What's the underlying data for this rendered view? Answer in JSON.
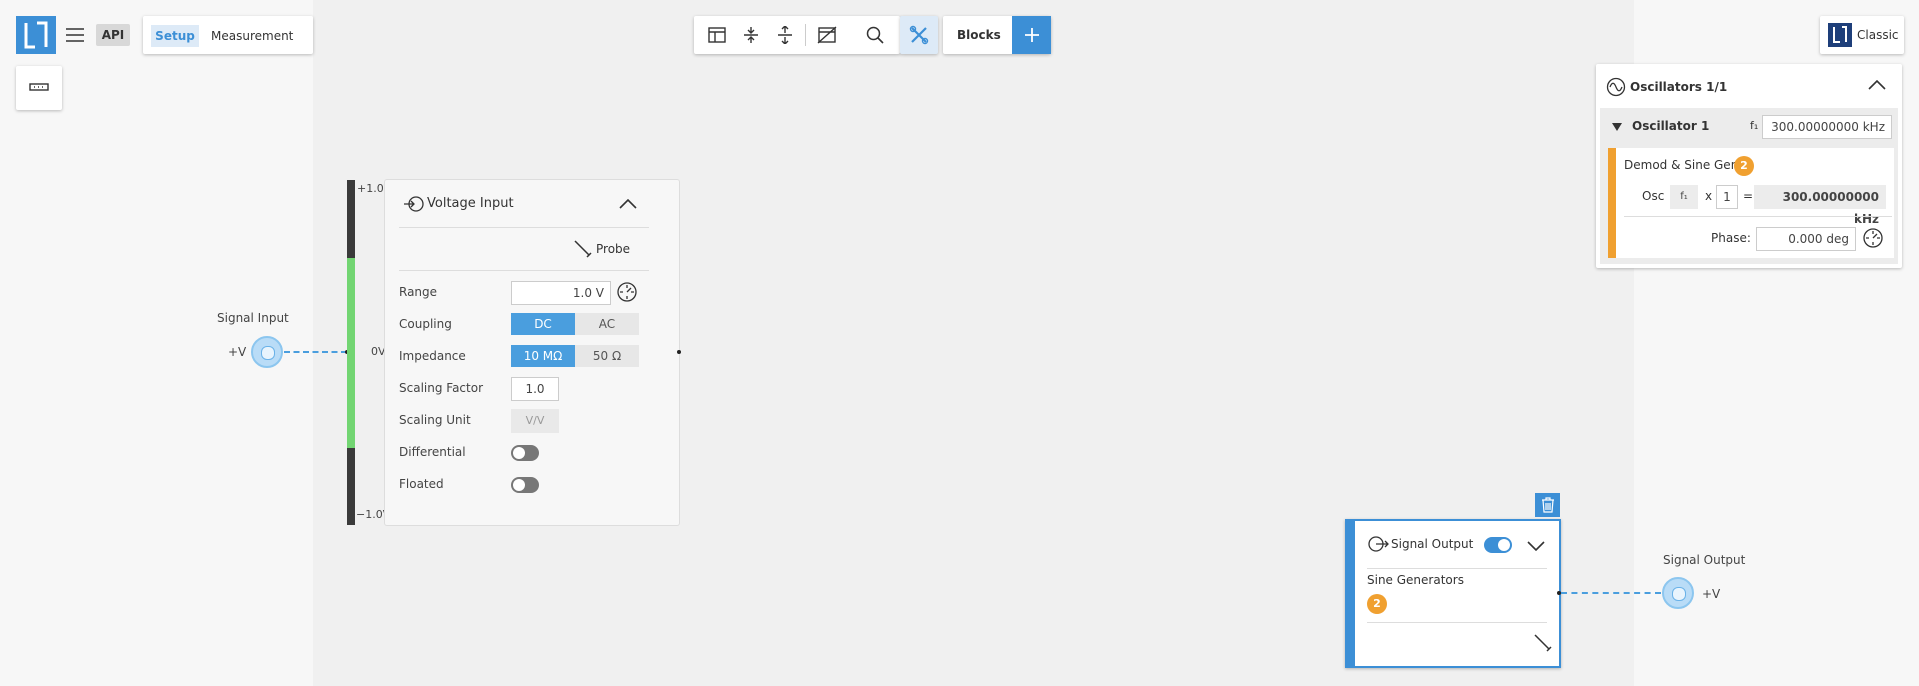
{
  "header": {
    "api_label": "API",
    "tabs": [
      {
        "label": "Setup"
      },
      {
        "label": "Measurement"
      }
    ],
    "blocks_label": "Blocks",
    "classic_label": "Classic"
  },
  "voltage_input": {
    "title": "Voltage Input",
    "probe_label": "Probe",
    "meter": {
      "top": "+1.0V",
      "mid": "0V",
      "bottom": "−1.0V"
    },
    "range_label": "Range",
    "range_value": "1.0 V",
    "coupling_label": "Coupling",
    "coupling_options": [
      "DC",
      "AC"
    ],
    "impedance_label": "Impedance",
    "impedance_options": [
      "10 MΩ",
      "50 Ω"
    ],
    "scaling_factor_label": "Scaling Factor",
    "scaling_factor_value": "1.0",
    "scaling_unit_label": "Scaling Unit",
    "scaling_unit_value": "V/V",
    "differential_label": "Differential",
    "floated_label": "Floated"
  },
  "signal_input": {
    "label": "Signal Input",
    "sign": "+V"
  },
  "signal_output_port": {
    "label": "Signal Output",
    "sign": "+V"
  },
  "signal_output": {
    "title": "Signal Output",
    "sine_label": "Sine Generators",
    "badge": "2"
  },
  "oscillators": {
    "title": "Oscillators 1/1",
    "osc_name": "Oscillator 1",
    "f_symbol": "f₁",
    "f_value": "300.00000000 kHz",
    "demod_label": "Demod & Sine Gen",
    "demod_badge": "2",
    "osc_label": "Osc",
    "multiplier_symbol": "x",
    "multiplier_value": "1",
    "equals": "=",
    "result_value": "300.00000000 kHz",
    "phase_label": "Phase:",
    "phase_value": "0.000 deg"
  },
  "colors": {
    "accent": "#4a9ede",
    "badge": "#f0a030",
    "meter_green": "#72d572"
  }
}
